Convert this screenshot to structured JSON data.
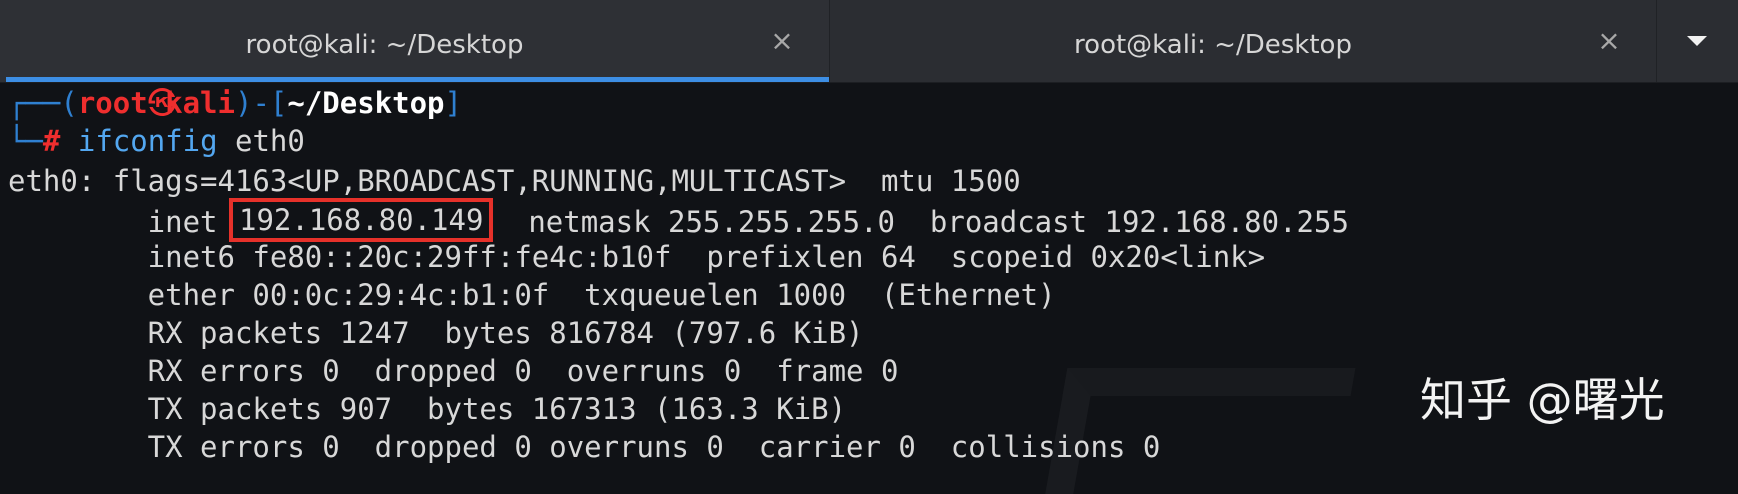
{
  "tabs": [
    {
      "title": "root@kali: ~/Desktop",
      "active": true,
      "close_icon": "×"
    },
    {
      "title": "root@kali: ~/Desktop",
      "active": false,
      "close_icon": "×"
    }
  ],
  "tab_menu_icon": "dropdown-arrow",
  "prompt": {
    "line1_prefix": "┌──(",
    "user": "root",
    "skull_icon": "㉿",
    "host": "kali",
    "line1_mid": ")-[",
    "path": "~/Desktop",
    "line1_suffix": "]",
    "line2_prefix": "└─",
    "symbol": "#",
    "command": "ifconfig",
    "argument": " eth0"
  },
  "output": {
    "line1": "eth0: flags=4163<UP,BROADCAST,RUNNING,MULTICAST>  mtu 1500",
    "inet_prefix": "        inet ",
    "inet_ip": "192.168.80.149",
    "inet_suffix": "  netmask 255.255.255.0  broadcast 192.168.80.255",
    "line3": "        inet6 fe80::20c:29ff:fe4c:b10f  prefixlen 64  scopeid 0x20<link>",
    "line4": "        ether 00:0c:29:4c:b1:0f  txqueuelen 1000  (Ethernet)",
    "line5": "        RX packets 1247  bytes 816784 (797.6 KiB)",
    "line6": "        RX errors 0  dropped 0  overruns 0  frame 0",
    "line7": "        TX packets 907  bytes 167313 (163.3 KiB)",
    "line8": "        TX errors 0  dropped 0 overruns 0  carrier 0  collisions 0"
  },
  "watermark": "知乎 @曙光",
  "colors": {
    "terminal_bg": "#101216",
    "tabbar_bg": "#2a2c31",
    "active_tab_indicator": "#3d8ee4",
    "prompt_frame": "#2f80d1",
    "prompt_user": "#ef2e2e",
    "command": "#53a7f0",
    "highlight_box": "#e6312a"
  }
}
